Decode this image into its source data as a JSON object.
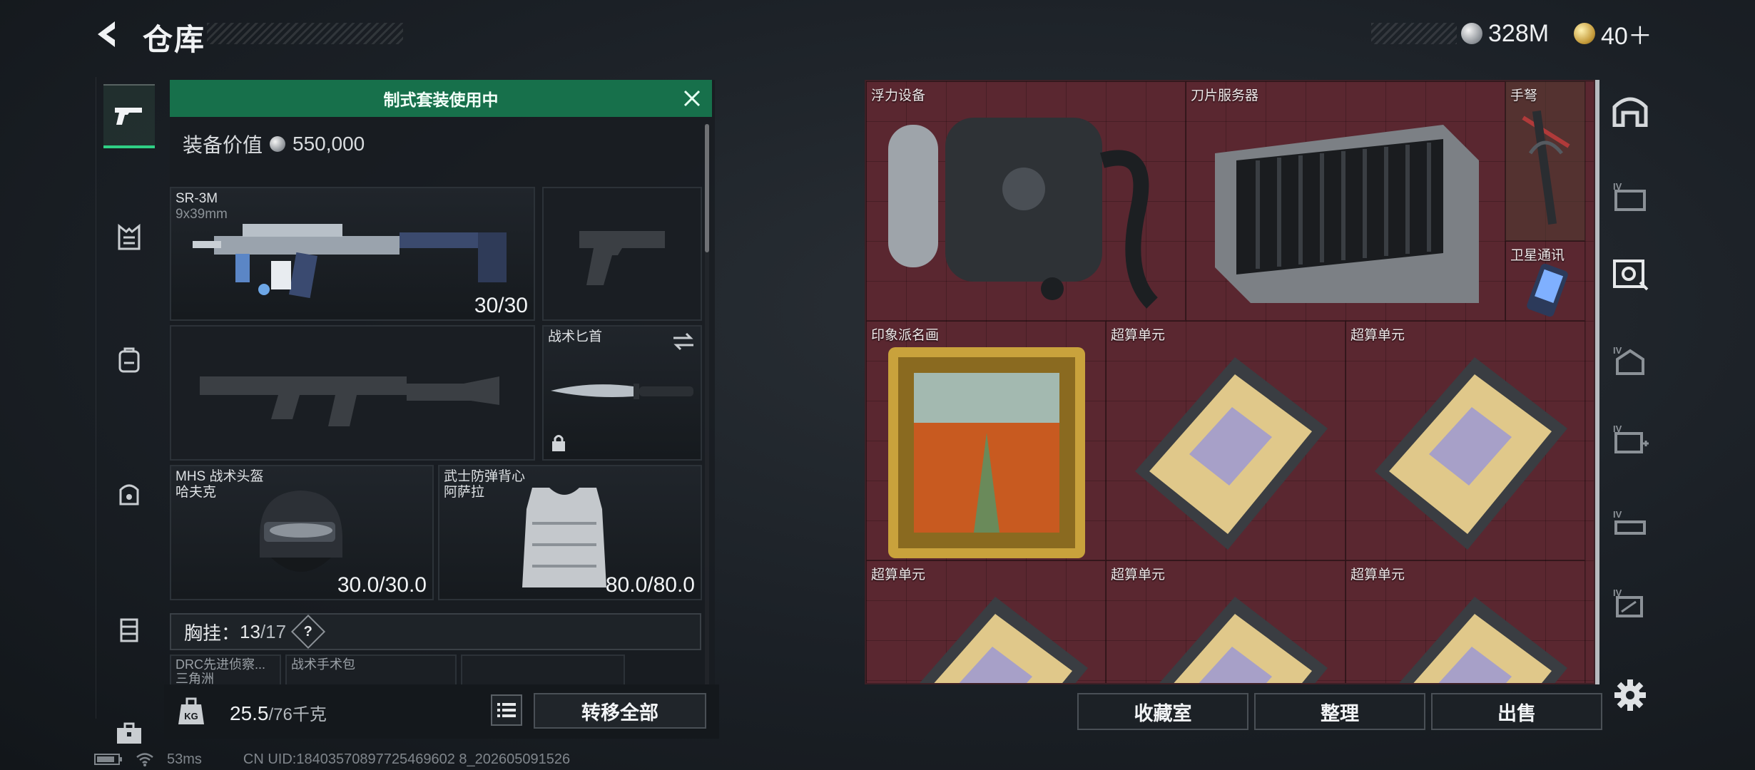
{
  "header": {
    "title": "仓库",
    "currencies": [
      {
        "icon": "silver-coin-icon",
        "value": "328M"
      },
      {
        "icon": "gold-coin-icon",
        "value": "40＋"
      }
    ]
  },
  "left_rail": [
    {
      "icon": "pistol-icon",
      "active": true
    },
    {
      "icon": "chest-rig-icon",
      "active": false
    },
    {
      "icon": "backpack-icon",
      "active": false
    },
    {
      "icon": "pouch-icon",
      "active": false
    },
    {
      "icon": "case-icon",
      "active": false
    },
    {
      "icon": "toolbox-icon",
      "active": false
    }
  ],
  "equipment": {
    "banner": "制式套装使用中",
    "value_label": "装备价值",
    "value": "550,000",
    "primary": {
      "name": "SR-3M",
      "ammo": "9x39mm",
      "count": "30/30"
    },
    "knife": {
      "name": "战术匕首"
    },
    "helmet": {
      "line1": "MHS 战术头盔",
      "line2": "哈夫克",
      "count": "30.0/30.0"
    },
    "armor": {
      "line1": "武士防弹背心",
      "line2": "阿萨拉",
      "count": "80.0/80.0"
    },
    "vest": {
      "label": "胸挂：",
      "count": "13",
      "capacity": "/17",
      "help": "?"
    },
    "mini_slots": [
      "DRC先进侦察... 三角洲",
      "战术手术包",
      ""
    ]
  },
  "weight": {
    "current": "25.5",
    "max": "/76千克"
  },
  "buttons": {
    "transfer_all": "转移全部",
    "collection": "收藏室",
    "organize": "整理",
    "sell": "出售"
  },
  "storage_items": [
    {
      "label": "浮力设备"
    },
    {
      "label": "刀片服务器"
    },
    {
      "label": "手弩"
    },
    {
      "label": "卫星通讯"
    },
    {
      "label": "印象派名画"
    },
    {
      "label": "超算单元"
    },
    {
      "label": "超算单元"
    },
    {
      "label": "超算单元"
    },
    {
      "label": "超算单元"
    },
    {
      "label": "超算单元"
    }
  ],
  "right_rail": [
    {
      "icon": "storage-home-icon"
    },
    {
      "icon": "folder-iv-icon"
    },
    {
      "icon": "camera-cabinet-icon"
    },
    {
      "icon": "backpack-iv-icon"
    },
    {
      "icon": "medkit-iv-icon"
    },
    {
      "icon": "rifle-iv-icon"
    },
    {
      "icon": "case-iv-icon"
    }
  ],
  "status": {
    "ping": "53ms",
    "uid": "CN UID:18403570897725469602 8_202605091526"
  }
}
